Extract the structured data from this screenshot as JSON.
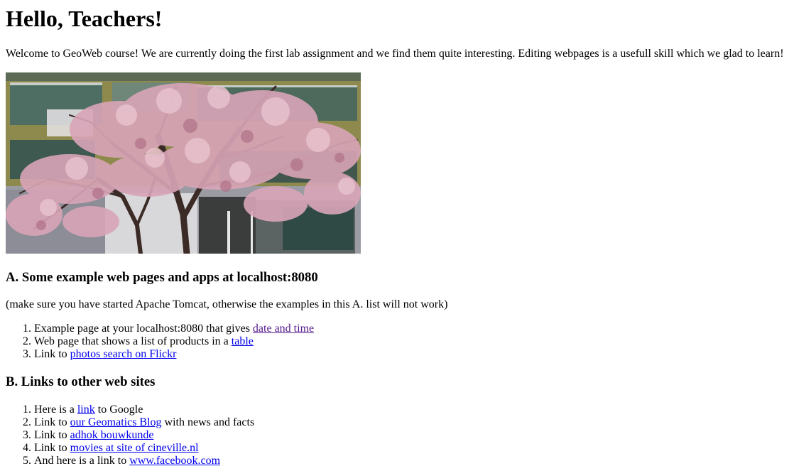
{
  "header": {
    "title": "Hello, Teachers!"
  },
  "intro": {
    "text": "Welcome to GeoWeb course! We are currently doing the first lab assignment and we find them quite interesting. Editing webpages is a usefull skill which we glad to learn!"
  },
  "image": {
    "subject": "blossoming cherry tree in front of a building"
  },
  "section_a": {
    "heading": "A. Some example web pages and apps at localhost:8080",
    "note": "(make sure you have started Apache Tomcat, otherwise the examples in this A. list will not work)",
    "items": [
      {
        "prefix": "Example page at your localhost:8080 that gives ",
        "link": "date and time",
        "suffix": ""
      },
      {
        "prefix": "Web page that shows a list of products in a ",
        "link": "table",
        "suffix": ""
      },
      {
        "prefix": "Link to ",
        "link": "photos search on Flickr",
        "suffix": ""
      }
    ]
  },
  "section_b": {
    "heading": "B. Links to other web sites",
    "items": [
      {
        "prefix": "Here is a ",
        "link": "link",
        "suffix": " to Google"
      },
      {
        "prefix": "Link to ",
        "link": "our Geomatics Blog",
        "suffix": " with news and facts"
      },
      {
        "prefix": "Link to ",
        "link": "adhok bouwkunde",
        "suffix": ""
      },
      {
        "prefix": "Link to ",
        "link": "movies at site of cineville.nl",
        "suffix": ""
      },
      {
        "prefix": "And here is a link to ",
        "link": "www.facebook.com",
        "suffix": ""
      }
    ]
  },
  "colors": {
    "link": "#0000ee",
    "visited_link": "#551a8b",
    "text": "#000000",
    "background": "#ffffff"
  }
}
